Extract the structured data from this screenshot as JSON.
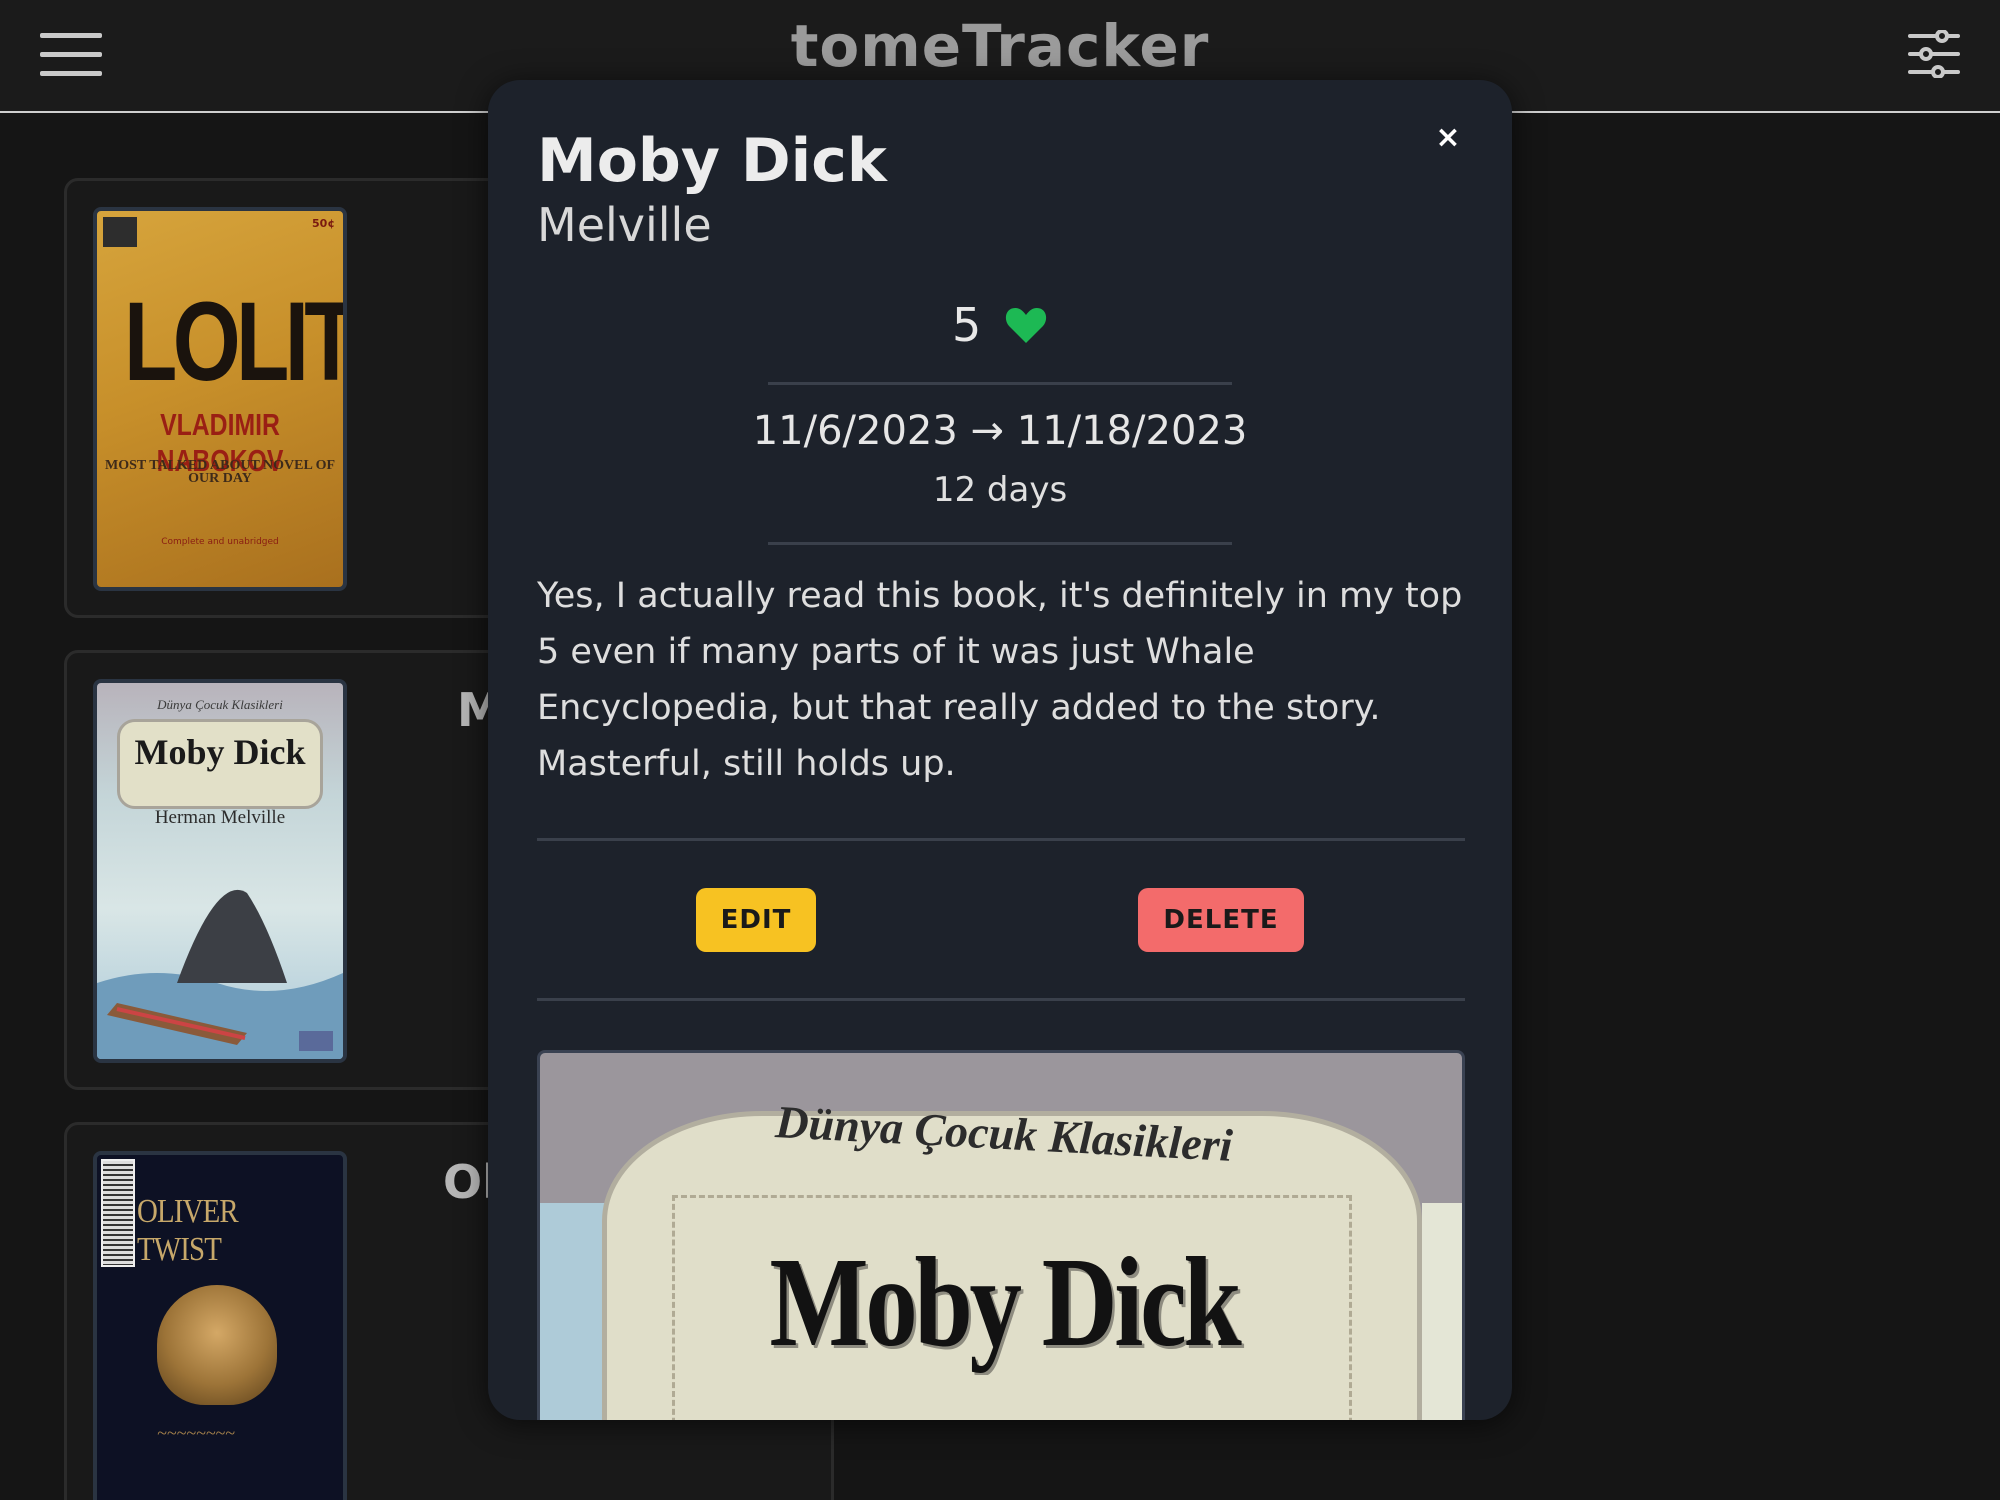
{
  "header": {
    "app_title": "tomeTracker",
    "menu_icon": "hamburger-menu-icon",
    "filter_icon": "sliders-filter-icon"
  },
  "book_list": [
    {
      "title": "",
      "cover": {
        "title": "LOLITA",
        "author": "VLADIMIR NABOKOV",
        "tagline": "MOST TALKED ABOUT NOVEL OF OUR DAY",
        "price": "50¢",
        "footer": "Complete and unabridged"
      }
    },
    {
      "title": "M",
      "cover": {
        "series": "Dünya Çocuk Klasikleri",
        "title": "Moby Dick",
        "author": "Herman Melville"
      }
    },
    {
      "title": "Ol",
      "cover": {
        "title": "OLIVER TWIST"
      }
    }
  ],
  "modal": {
    "title": "Moby Dick",
    "author": "Melville",
    "rating": "5",
    "rating_icon": "heart-icon",
    "dates": "11/6/2023 → 11/18/2023",
    "duration": "12 days",
    "review": "Yes, I actually read this book, it's definitely in my top 5 even if many parts of it was just Whale Encyclopedia, but that really added to the story. Masterful, still holds up.",
    "close_label": "×",
    "edit_label": "EDIT",
    "delete_label": "DELETE",
    "cover": {
      "series": "Dünya Çocuk Klasikleri",
      "title": "Moby Dick"
    }
  },
  "colors": {
    "background": "#151515",
    "modal_bg": "#1d222b",
    "heart": "#1db954",
    "edit": "#f7c222",
    "delete": "#f36b6b"
  }
}
